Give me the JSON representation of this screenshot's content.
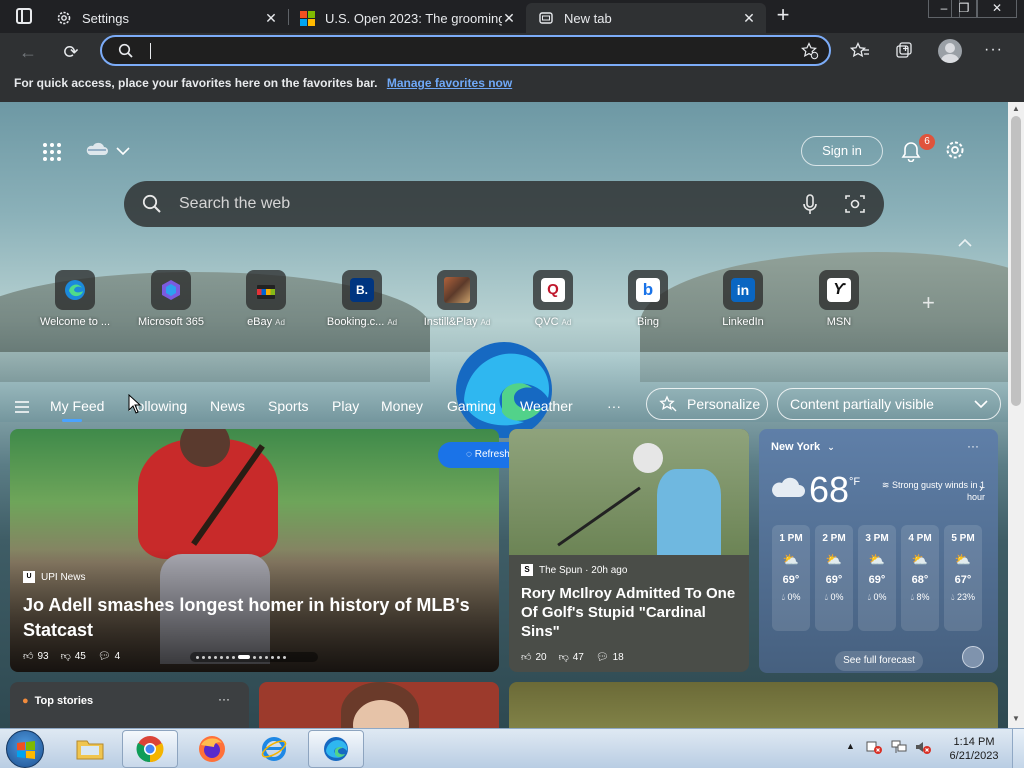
{
  "browser": {
    "tabs": [
      {
        "title": "Settings",
        "icon": "gear-icon"
      },
      {
        "title": "U.S. Open 2023: The grooming n",
        "icon": "microsoft-logo-icon"
      },
      {
        "title": "New tab",
        "icon": "newtab-icon"
      }
    ],
    "address_value": "",
    "favorites_bar": {
      "message": "For quick access, place your favorites here on the favorites bar.",
      "link": "Manage favorites now"
    }
  },
  "newtab": {
    "sign_in": "Sign in",
    "notification_count": "6",
    "search_placeholder": "Search the web",
    "quick_links": [
      {
        "label": "Welcome to ...",
        "ad": "",
        "icon": "edge-icon"
      },
      {
        "label": "Microsoft 365",
        "ad": "",
        "icon": "m365-icon"
      },
      {
        "label": "eBay",
        "ad": "Ad",
        "icon": "ebay-icon"
      },
      {
        "label": "Booking.c...",
        "ad": "Ad",
        "icon": "booking-icon"
      },
      {
        "label": "Instill&Play",
        "ad": "Ad",
        "icon": "game-icon"
      },
      {
        "label": "QVC",
        "ad": "Ad",
        "icon": "qvc-icon"
      },
      {
        "label": "Bing",
        "ad": "",
        "icon": "bing-icon"
      },
      {
        "label": "LinkedIn",
        "ad": "",
        "icon": "linkedin-icon"
      },
      {
        "label": "MSN",
        "ad": "",
        "icon": "msn-icon"
      }
    ],
    "feed_nav": [
      "My Feed",
      "Following",
      "News",
      "Sports",
      "Play",
      "Money",
      "Gaming",
      "Weather"
    ],
    "more": "···",
    "personalize": "Personalize",
    "visibility": "Content partially visible",
    "refresh": "Refresh stories"
  },
  "cards": {
    "main": {
      "source": "UPI News",
      "title": "Jo Adell smashes longest homer in history of MLB's Statcast",
      "likes": "93",
      "dislikes": "45",
      "comments": "4"
    },
    "second": {
      "source": "The Spun · 20h ago",
      "title": "Rory McIlroy Admitted To One Of Golf's Stupid \"Cardinal Sins\"",
      "likes": "20",
      "dislikes": "47",
      "comments": "18"
    },
    "top_stories": "Top stories"
  },
  "weather": {
    "location": "New York",
    "temp": "68",
    "unit": "°F",
    "alert": "Strong gusty winds in 1 hour",
    "hours": [
      {
        "hour": "1 PM",
        "temp": "69°",
        "precip": "0%"
      },
      {
        "hour": "2 PM",
        "temp": "69°",
        "precip": "0%"
      },
      {
        "hour": "3 PM",
        "temp": "69°",
        "precip": "0%"
      },
      {
        "hour": "4 PM",
        "temp": "68°",
        "precip": "8%"
      },
      {
        "hour": "5 PM",
        "temp": "67°",
        "precip": "23%"
      }
    ],
    "forecast_link": "See full forecast"
  },
  "taskbar": {
    "time": "1:14 PM",
    "date": "6/21/2023"
  }
}
